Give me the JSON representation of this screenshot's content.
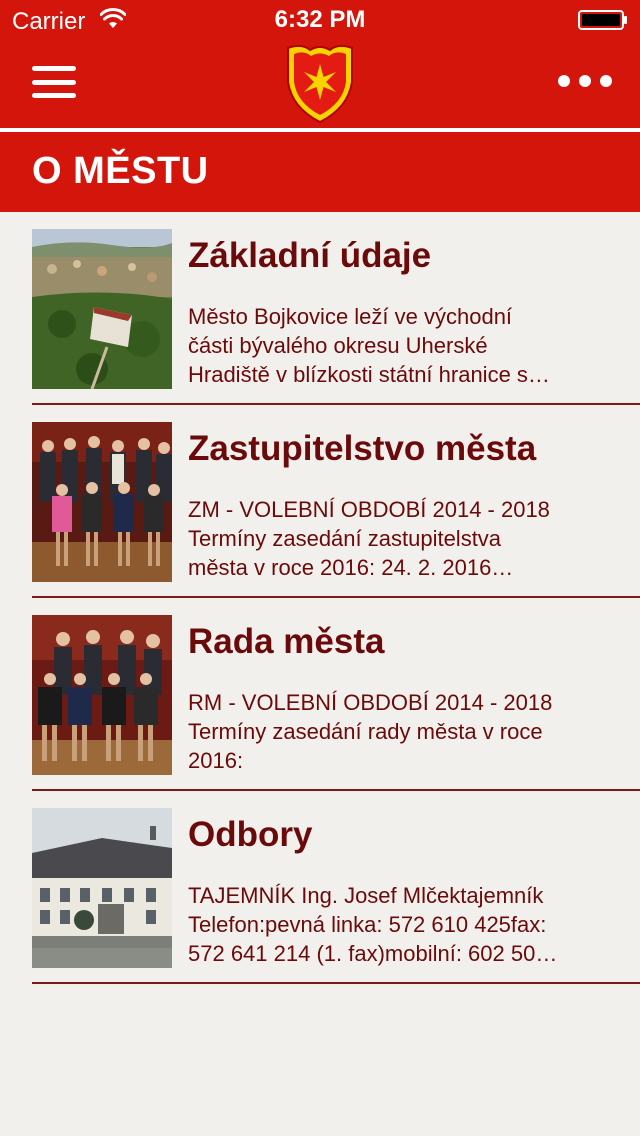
{
  "status_bar": {
    "carrier": "Carrier",
    "time": "6:32 PM"
  },
  "nav": {
    "menu_icon": "hamburger-menu-icon",
    "logo": "bojkovice-coat-of-arms",
    "more_icon": "more-dots-icon"
  },
  "section": {
    "title": "O MĚSTU"
  },
  "items": [
    {
      "title": "Základní údaje",
      "description": "Město Bojkovice leží ve východní\nčásti bývalého okresu Uherské\nHradiště v blízkosti státní hranice s…",
      "image": "aerial-town-photo"
    },
    {
      "title": "Zastupitelstvo města",
      "description": "ZM - VOLEBNÍ OBDOBÍ 2014 - 2018\nTermíny zasedání zastupitelstva\nměsta v roce 2016:      24. 2. 2016…",
      "image": "council-group-photo"
    },
    {
      "title": "Rada města",
      "description": "RM - VOLEBNÍ OBDOBÍ 2014 - 2018\nTermíny zasedání rady města v roce\n2016:",
      "image": "board-group-photo"
    },
    {
      "title": "Odbory",
      "description": "TAJEMNÍK  Ing. Josef Mlčektajemník\nTelefon:pevná linka: 572 610 425fax:\n572 641 214 (1. fax)mobilní: 602 50…",
      "image": "town-hall-photo"
    }
  ],
  "colors": {
    "brand_red": "#d3150c",
    "text_dark_red": "#6b0a0a",
    "background": "#f1f0ec"
  }
}
